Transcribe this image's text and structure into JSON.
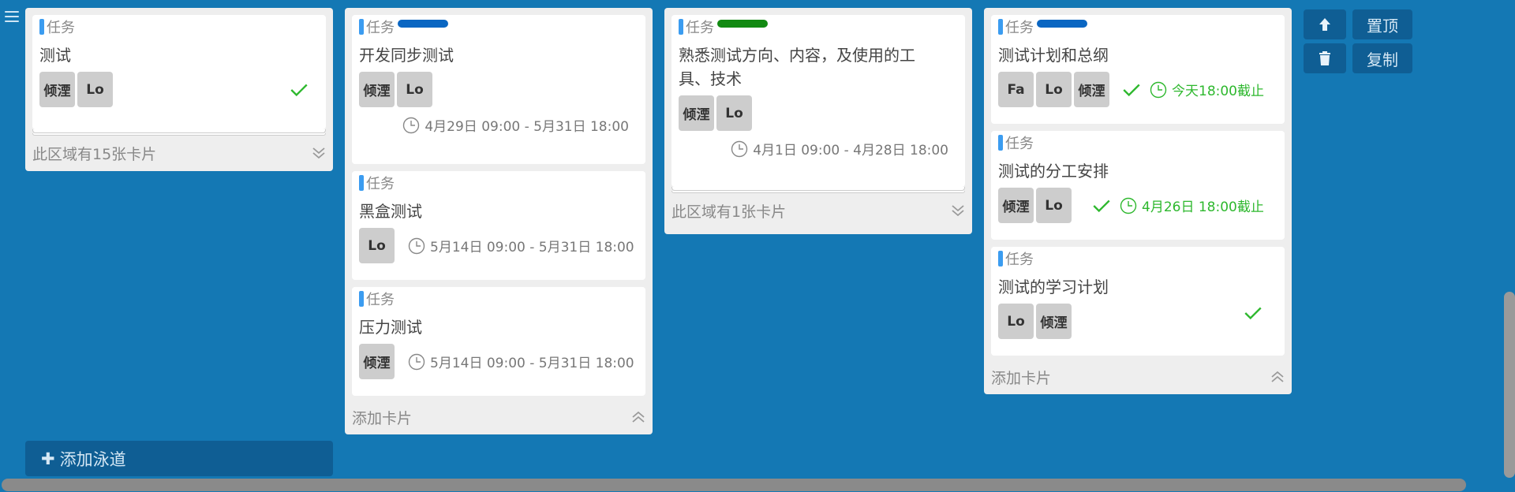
{
  "icons": {
    "menu": "hamburger-icon",
    "check": "checkmark-icon",
    "clock": "clock-icon",
    "chevron_down": "double-chevron-down-icon",
    "chevron_up": "double-chevron-up-icon",
    "arrow_up": "arrow-up-icon",
    "trash": "trash-icon",
    "plus": "plus-icon"
  },
  "colors": {
    "background": "#1478b4",
    "type_bar": "#3b9cf0",
    "tag_blue": "#0a66c2",
    "tag_green": "#128a12",
    "done_green": "#2eb82e"
  },
  "lanes": [
    {
      "cards": [
        {
          "type": "任务",
          "title": "测试",
          "avatars": [
            "倾湮",
            "Lo"
          ]
        }
      ],
      "footer": "此区域有15张卡片"
    },
    {
      "cards": [
        {
          "type": "任务",
          "title": "开发同步测试",
          "avatars": [
            "倾湮",
            "Lo"
          ],
          "date": "4月29日 09:00 - 5月31日 18:00"
        },
        {
          "type": "任务",
          "title": "黑盒测试",
          "avatars": [
            "Lo"
          ],
          "date": "5月14日 09:00 - 5月31日 18:00"
        },
        {
          "type": "任务",
          "title": "压力测试",
          "avatars": [
            "倾湮"
          ],
          "date": "5月14日 09:00 - 5月31日 18:00"
        }
      ],
      "footer": "添加卡片"
    },
    {
      "cards": [
        {
          "type": "任务",
          "title": "熟悉测试方向、内容，及使用的工具、技术",
          "avatars": [
            "倾湮",
            "Lo"
          ],
          "date": "4月1日 09:00 - 4月28日 18:00"
        }
      ],
      "footer": "此区域有1张卡片"
    },
    {
      "cards": [
        {
          "type": "任务",
          "title": "测试计划和总纲",
          "avatars": [
            "Fa",
            "Lo",
            "倾湮"
          ],
          "deadline": "今天18:00截止"
        },
        {
          "type": "任务",
          "title": "测试的分工安排",
          "avatars": [
            "倾湮",
            "Lo"
          ],
          "deadline": "4月26日 18:00截止"
        },
        {
          "type": "任务",
          "title": "测试的学习计划",
          "avatars": [
            "Lo",
            "倾湮"
          ]
        }
      ],
      "footer": "添加卡片"
    }
  ],
  "actions": {
    "pin_top": "置顶",
    "copy": "复制"
  },
  "add_lane": "添加泳道"
}
